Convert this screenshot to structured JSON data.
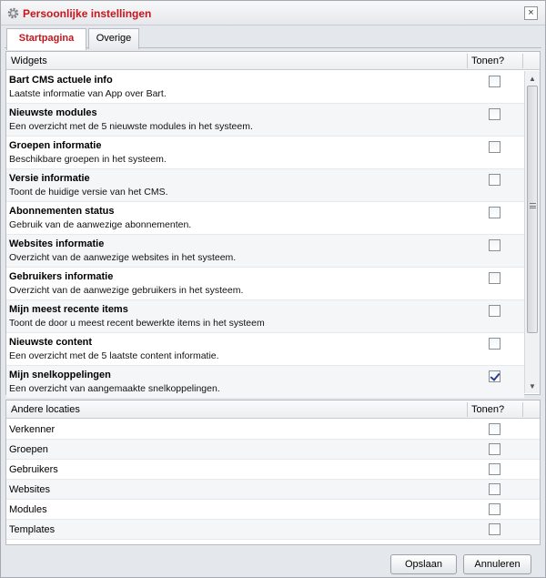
{
  "window": {
    "title": "Persoonlijke instellingen",
    "close_label": "×",
    "title_icon": "gear-icon",
    "close_icon": "close-icon"
  },
  "tabs": [
    {
      "label": "Startpagina",
      "active": true
    },
    {
      "label": "Overige",
      "active": false
    }
  ],
  "widgets": {
    "header": {
      "name": "Widgets",
      "show": "Tonen?"
    },
    "items": [
      {
        "title": "Bart CMS actuele info",
        "description": "Laatste informatie van App over Bart.",
        "checked": false
      },
      {
        "title": "Nieuwste modules",
        "description": "Een overzicht met de 5 nieuwste modules in het systeem.",
        "checked": false
      },
      {
        "title": "Groepen informatie",
        "description": "Beschikbare groepen in het systeem.",
        "checked": false
      },
      {
        "title": "Versie informatie",
        "description": "Toont de huidige versie van het CMS.",
        "checked": false
      },
      {
        "title": "Abonnementen status",
        "description": "Gebruik van de aanwezige abonnementen.",
        "checked": false
      },
      {
        "title": "Websites informatie",
        "description": "Overzicht van de aanwezige websites in het systeem.",
        "checked": false
      },
      {
        "title": "Gebruikers informatie",
        "description": "Overzicht van de aanwezige gebruikers in het systeem.",
        "checked": false
      },
      {
        "title": "Mijn meest recente items",
        "description": "Toont de door u meest recent bewerkte items in het systeem",
        "checked": false
      },
      {
        "title": "Nieuwste content",
        "description": "Een overzicht met de 5 laatste content informatie.",
        "checked": false
      },
      {
        "title": "Mijn snelkoppelingen",
        "description": "Een overzicht van aangemaakte snelkoppelingen.",
        "checked": true
      }
    ]
  },
  "locations": {
    "header": {
      "name": "Andere locaties",
      "show": "Tonen?"
    },
    "items": [
      {
        "label": "Verkenner",
        "checked": false
      },
      {
        "label": "Groepen",
        "checked": false
      },
      {
        "label": "Gebruikers",
        "checked": false
      },
      {
        "label": "Websites",
        "checked": false
      },
      {
        "label": "Modules",
        "checked": false
      },
      {
        "label": "Templates",
        "checked": false
      }
    ]
  },
  "footer": {
    "save_label": "Opslaan",
    "cancel_label": "Annuleren"
  },
  "colors": {
    "accent": "#c4161c",
    "check": "#2a3f8f"
  }
}
